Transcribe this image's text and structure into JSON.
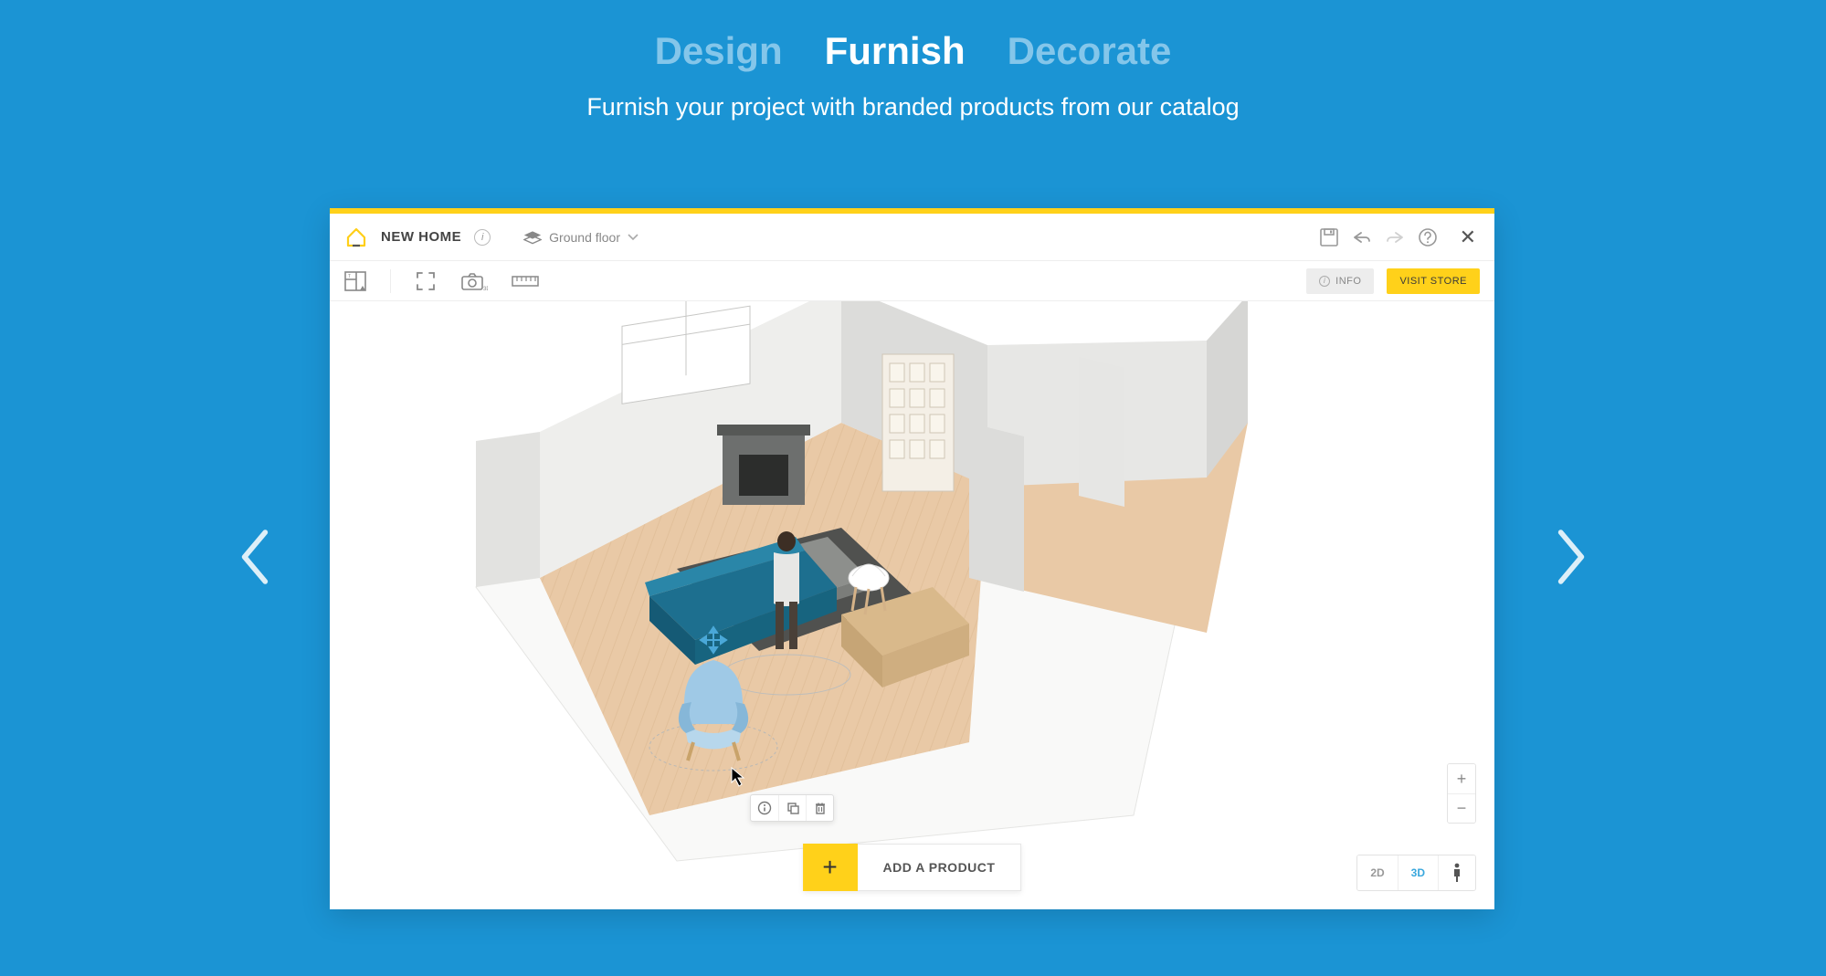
{
  "hero": {
    "tabs": {
      "design": "Design",
      "furnish": "Furnish",
      "decorate": "Decorate"
    },
    "subtitle": "Furnish your project with branded products from our catalog"
  },
  "app": {
    "project_name": "NEW HOME",
    "floor_label": "Ground floor",
    "info_btn": "INFO",
    "visit_store_btn": "VISIT STORE",
    "add_product_btn": "ADD A PRODUCT",
    "view": {
      "two_d": "2D",
      "three_d": "3D"
    },
    "zoom": {
      "in": "+",
      "out": "−"
    }
  }
}
